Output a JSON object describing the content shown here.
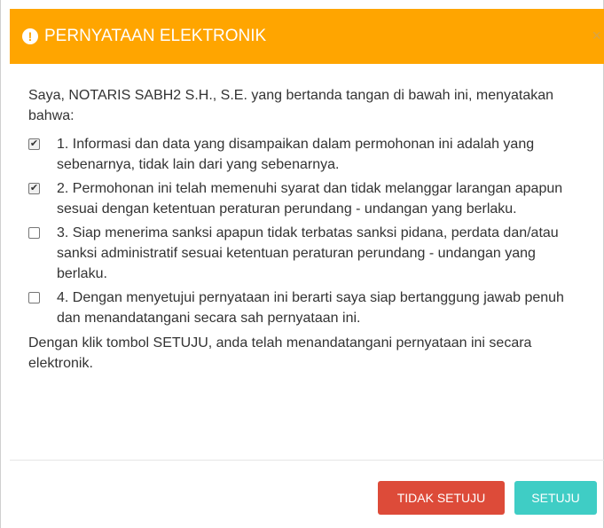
{
  "dialog": {
    "title": "PERNYATAAN ELEKTRONIK",
    "close": "×",
    "header_color": "#ffa500",
    "intro": "Saya, NOTARIS SABH2 S.H., S.E. yang bertanda tangan di bawah ini, menyatakan bahwa:",
    "items": [
      {
        "checked": true,
        "text": "1. Informasi dan data yang disampaikan dalam permohonan ini adalah yang sebenarnya, tidak lain dari yang sebenarnya."
      },
      {
        "checked": true,
        "text": "2. Permohonan ini telah memenuhi syarat dan tidak melanggar larangan apapun sesuai dengan ketentuan peraturan perundang - undangan yang berlaku."
      },
      {
        "checked": false,
        "text": "3. Siap menerima sanksi apapun tidak terbatas sanksi pidana, perdata dan/atau sanksi administratif sesuai ketentuan peraturan perundang - undangan yang berlaku."
      },
      {
        "checked": false,
        "text": "4. Dengan menyetujui pernyataan ini berarti saya siap bertanggung jawab penuh dan menandatangani secara sah pernyataan ini."
      }
    ],
    "closing": "Dengan klik tombol SETUJU, anda telah menandatangani pernyataan ini secara elektronik.",
    "buttons": {
      "reject": "TIDAK SETUJU",
      "accept": "SETUJU",
      "reject_color": "#dd4b39",
      "accept_color": "#3fcdc5"
    }
  }
}
